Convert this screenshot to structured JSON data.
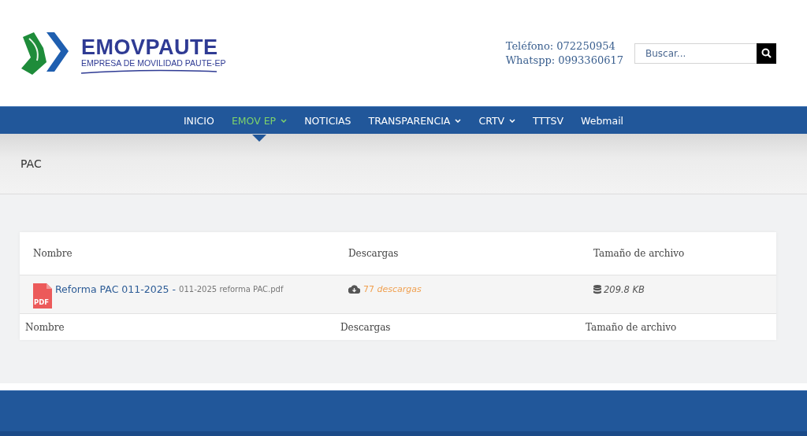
{
  "logo": {
    "name": "EMOVPAUTE",
    "tagline": "EMPRESA DE MOVILIDAD PAUTE-EP"
  },
  "contact": [
    "Teléfono: 072250954",
    "Whatspp: 0993360617"
  ],
  "search": {
    "placeholder": "Buscar..."
  },
  "nav": [
    {
      "label": "INICIO",
      "selected": false,
      "dropdown": false
    },
    {
      "label": "EMOV EP",
      "selected": true,
      "dropdown": true
    },
    {
      "label": "NOTICIAS",
      "selected": false,
      "dropdown": false
    },
    {
      "label": "TRANSPARENCIA",
      "selected": false,
      "dropdown": true
    },
    {
      "label": "CRTV",
      "selected": false,
      "dropdown": true
    },
    {
      "label": "TTTSV",
      "selected": false,
      "dropdown": false
    },
    {
      "label": "Webmail",
      "selected": false,
      "dropdown": false
    }
  ],
  "page_title": "PAC",
  "table": {
    "columns": [
      "Nombre",
      "Descargas",
      "Tamaño de archivo"
    ],
    "rows": [
      {
        "icon_label": "PDF",
        "title": "Reforma PAC 011-2025",
        "separator": "-",
        "filename": "011-2025 reforma PAC.pdf",
        "downloads_count": "77",
        "downloads_label": "descargas",
        "size": "209.8 KB"
      }
    ],
    "footer_columns": [
      "Nombre",
      "Descargas",
      "Tamaño de archivo"
    ]
  }
}
